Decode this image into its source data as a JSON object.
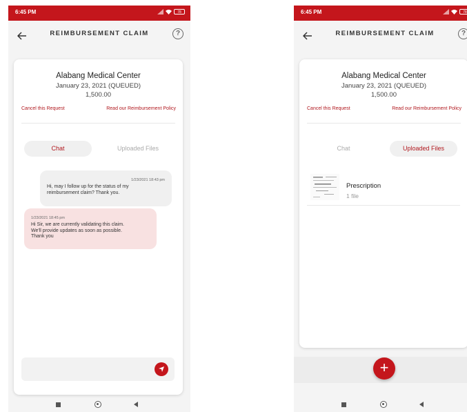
{
  "status": {
    "time": "6:45 PM",
    "battery": "78"
  },
  "header": {
    "title": "REIMBURSEMENT CLAIM"
  },
  "claim": {
    "clinic": "Alabang Medical Center",
    "date": "January 23, 2021 (QUEUED)",
    "amount": "1,500.00",
    "cancel_link": "Cancel this Request",
    "policy_link": "Read our Reimbursement Policy"
  },
  "tabs": {
    "chat": "Chat",
    "files": "Uploaded Files"
  },
  "messages": [
    {
      "time": "1/23/2021 18:43 pm",
      "text": [
        "Hi, may I follow up for the status of my",
        "reimbursement claim? Thank you."
      ]
    },
    {
      "time": "1/23/2021 18:45 pm",
      "text": [
        "Hi Sir, we are currently validating this claim.",
        "We'll provide updates as soon as possible.",
        "Thank you"
      ]
    }
  ],
  "file": {
    "name": "Prescription",
    "count": "1 file"
  },
  "fab": {
    "label": "+"
  },
  "colors": {
    "accent": "#c4161c",
    "link": "#b0171d",
    "incoming_bubble": "#f8e1e1"
  },
  "icons": [
    "back-arrow-icon",
    "help-icon",
    "send-icon",
    "add-icon",
    "wifi-icon",
    "battery-icon",
    "nav-recents-icon",
    "nav-home-icon",
    "nav-back-icon"
  ]
}
